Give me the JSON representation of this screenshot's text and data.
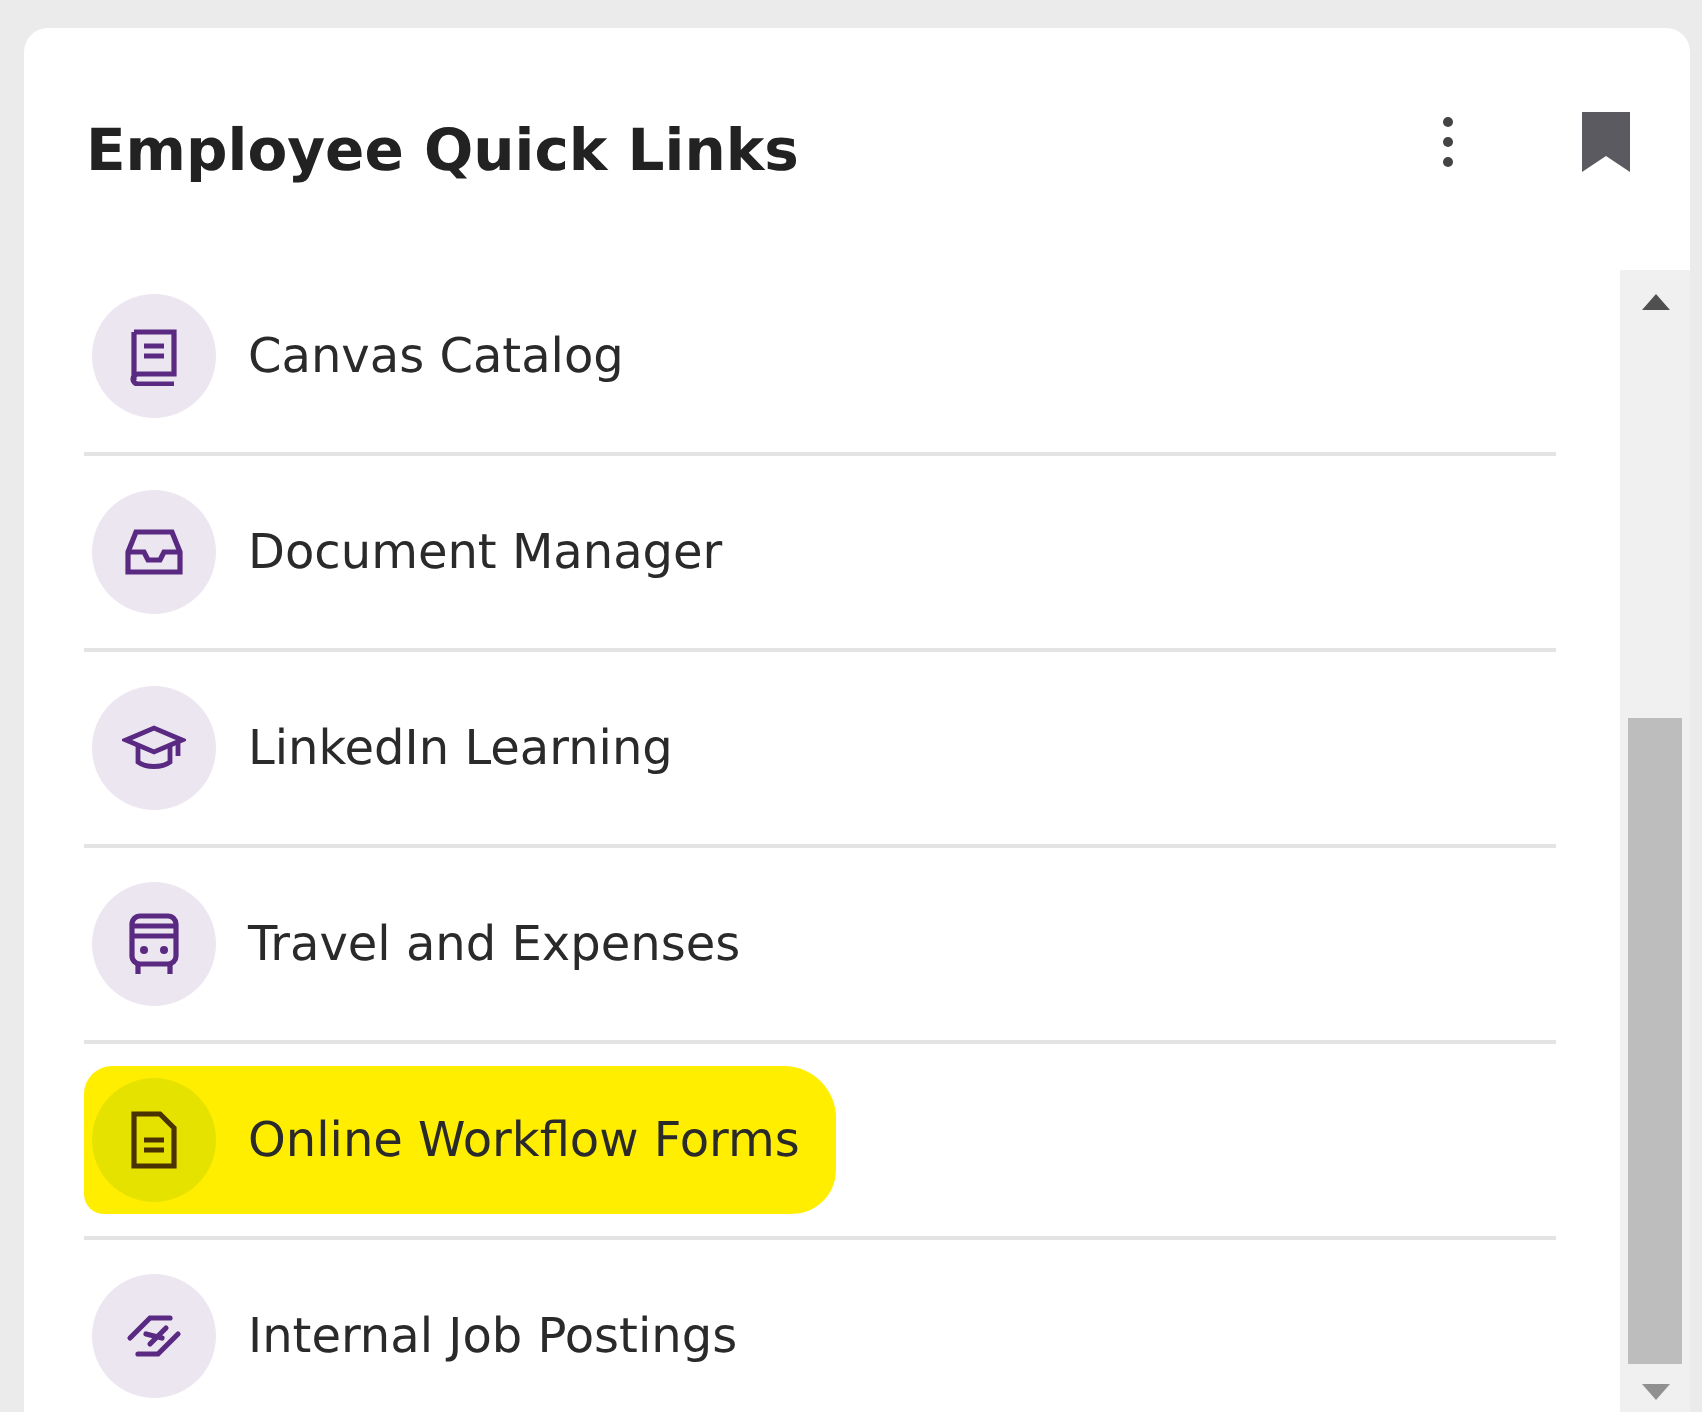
{
  "card": {
    "title": "Employee Quick Links"
  },
  "links": [
    {
      "label": "Canvas Catalog",
      "highlighted": false
    },
    {
      "label": "Document Manager",
      "highlighted": false
    },
    {
      "label": "LinkedIn Learning",
      "highlighted": false
    },
    {
      "label": "Travel and Expenses",
      "highlighted": false
    },
    {
      "label": "Online Workflow Forms",
      "highlighted": true
    },
    {
      "label": "Internal Job Postings",
      "highlighted": false
    }
  ]
}
